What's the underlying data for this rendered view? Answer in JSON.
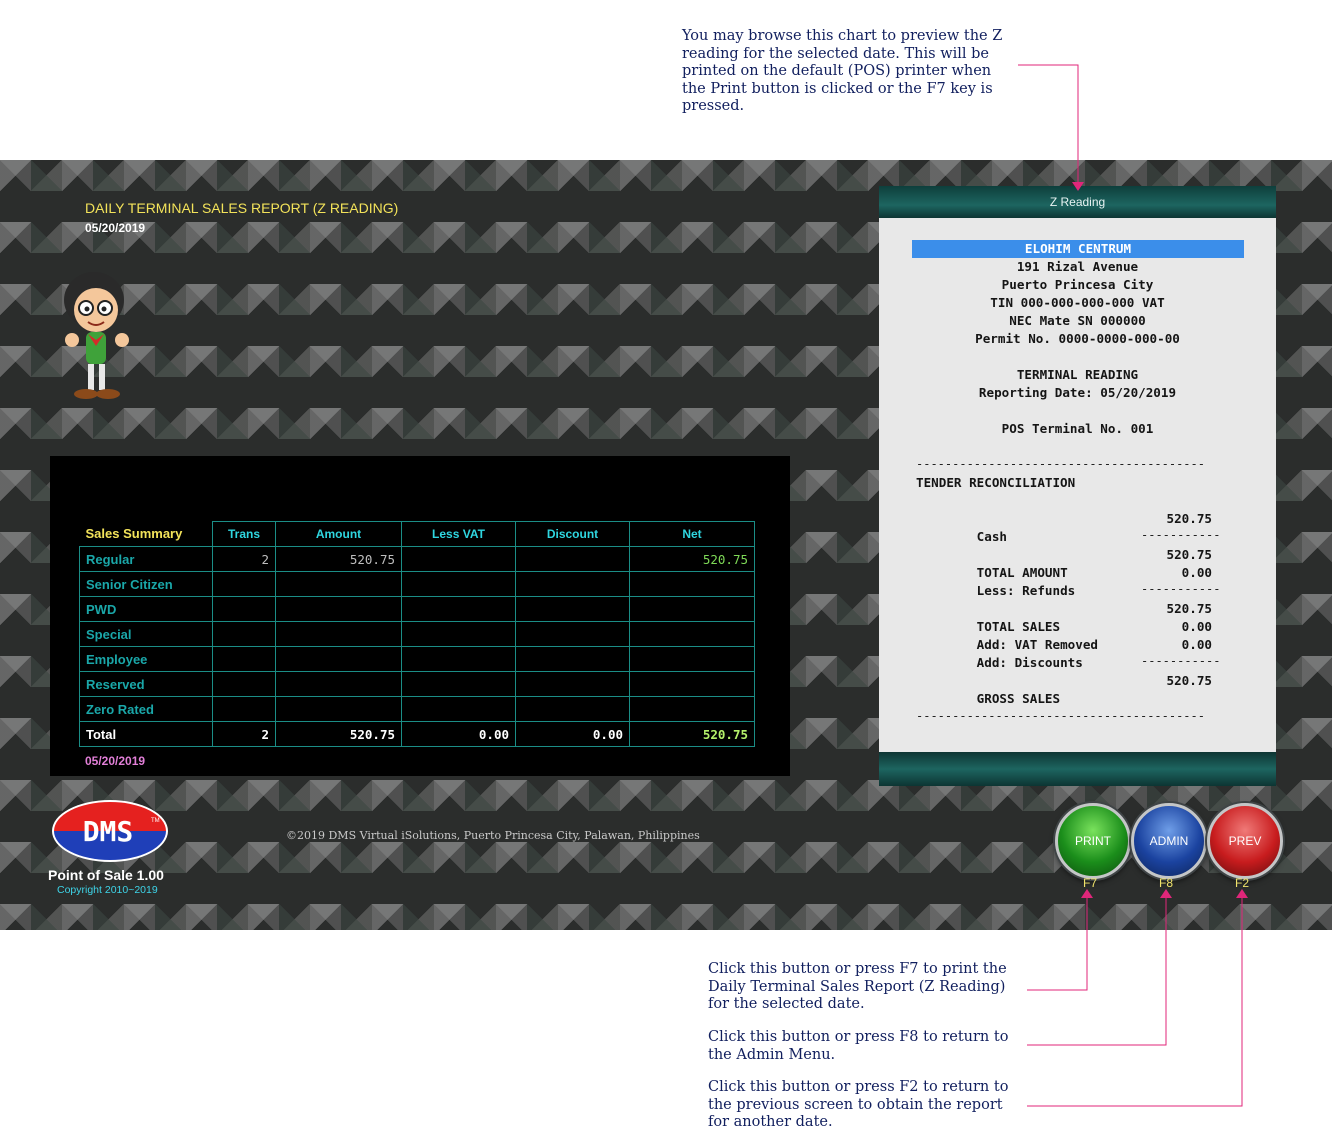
{
  "notes": {
    "top": "You may browse this chart to preview the Z\nreading for the selected date. This will be\nprinted on the default (POS) printer when\nthe Print button is clicked or the F7 key is\npressed.",
    "print": "Click this button or press F7 to print the\nDaily Terminal Sales Report (Z Reading)\nfor the selected date.",
    "admin": "Click this button or press F8 to return to\nthe Admin Menu.",
    "prev": "Click this button or press F2 to return to\nthe previous screen to obtain the report\nfor another date."
  },
  "report": {
    "title": "DAILY TERMINAL SALES REPORT (Z READING)",
    "date": "05/20/2019",
    "panel_date": "05/20/2019"
  },
  "summary": {
    "headers": [
      "Sales Summary",
      "Trans",
      "Amount",
      "Less VAT",
      "Discount",
      "Net"
    ],
    "rows": [
      {
        "label": "Regular",
        "trans": "2",
        "amount": "520.75",
        "less_vat": "",
        "discount": "",
        "net": "520.75"
      },
      {
        "label": "Senior Citizen",
        "trans": "",
        "amount": "",
        "less_vat": "",
        "discount": "",
        "net": ""
      },
      {
        "label": "PWD",
        "trans": "",
        "amount": "",
        "less_vat": "",
        "discount": "",
        "net": ""
      },
      {
        "label": "Special",
        "trans": "",
        "amount": "",
        "less_vat": "",
        "discount": "",
        "net": ""
      },
      {
        "label": "Employee",
        "trans": "",
        "amount": "",
        "less_vat": "",
        "discount": "",
        "net": ""
      },
      {
        "label": "Reserved",
        "trans": "",
        "amount": "",
        "less_vat": "",
        "discount": "",
        "net": ""
      },
      {
        "label": "Zero Rated",
        "trans": "",
        "amount": "",
        "less_vat": "",
        "discount": "",
        "net": ""
      }
    ],
    "total": {
      "label": "Total",
      "trans": "2",
      "amount": "520.75",
      "less_vat": "0.00",
      "discount": "0.00",
      "net": "520.75"
    }
  },
  "receipt": {
    "header": "Z Reading",
    "store_name": "ELOHIM CENTRUM",
    "address1": "191 Rizal Avenue",
    "address2": "Puerto Princesa City",
    "tin": "TIN 000-000-000-000 VAT",
    "machine": "NEC Mate SN 000000",
    "permit": "Permit No. 0000-0000-000-00",
    "reading_title": "TERMINAL READING",
    "reporting_date": "Reporting Date: 05/20/2019",
    "terminal": "POS Terminal No. 001",
    "rule": "----------------------------------------",
    "subrule": "-----------",
    "tender_title": "TENDER RECONCILIATION",
    "cash_label": "Cash",
    "cash_value": "520.75",
    "total_amount_label": "TOTAL AMOUNT",
    "total_amount_value": "520.75",
    "refunds_label": "Less: Refunds",
    "refunds_value": "0.00",
    "total_sales_label": "TOTAL SALES",
    "total_sales_value": "520.75",
    "vat_removed_label": "Add: VAT Removed",
    "vat_removed_value": "0.00",
    "discounts_label": "Add: Discounts",
    "discounts_value": "0.00",
    "gross_sales_label": "GROSS SALES",
    "gross_sales_value": "520.75"
  },
  "footer": {
    "logo_text": "DMS",
    "logo_tm": "TM",
    "product": "Point of Sale 1.00",
    "product_copyright": "Copyright 2010~2019",
    "copyright": "©2019  DMS Virtual iSolutions, Puerto Princesa City, Palawan, Philippines"
  },
  "buttons": {
    "print": {
      "label": "PRINT",
      "key": "F7"
    },
    "admin": {
      "label": "ADMIN",
      "key": "F8"
    },
    "prev": {
      "label": "PREV",
      "key": "F2"
    }
  },
  "colors": {
    "note_text": "#111f5e",
    "leader": "#e0267a",
    "title_yellow": "#f3e35a",
    "grid_teal": "#1b8d86",
    "highlight_blue": "#3b8eea"
  }
}
